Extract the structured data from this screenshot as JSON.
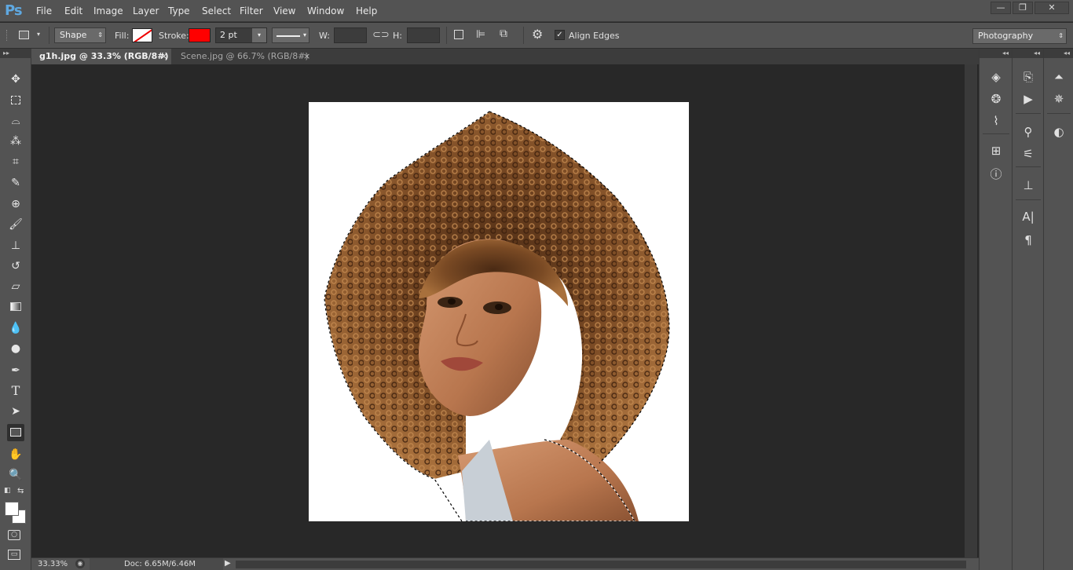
{
  "app": {
    "logo": "Ps"
  },
  "menu": [
    "File",
    "Edit",
    "Image",
    "Layer",
    "Type",
    "Select",
    "Filter",
    "View",
    "Window",
    "Help"
  ],
  "window_controls": {
    "minimize": "—",
    "restore": "❐",
    "close": "✕"
  },
  "options_bar": {
    "mode": "Shape",
    "fill_label": "Fill:",
    "stroke_label": "Stroke:",
    "stroke_color": "#ff0000",
    "stroke_width": "2 pt",
    "w_label": "W:",
    "h_label": "H:",
    "align_edges_label": "Align Edges",
    "align_edges_checked": true,
    "workspace": "Photography"
  },
  "tabs": [
    {
      "title": "g1h.jpg @ 33.3% (RGB/8#) *",
      "active": true,
      "close": "×"
    },
    {
      "title": "Scene.jpg @ 66.7% (RGB/8#)",
      "active": false,
      "close": "×"
    }
  ],
  "status": {
    "zoom": "33.33%",
    "doc": "Doc: 6.65M/6.46M",
    "arrow": "▶"
  },
  "panel_collapse": "◂◂",
  "tools": [
    "move-tool",
    "marquee-tool",
    "lasso-tool",
    "magic-wand-tool",
    "crop-tool",
    "eyedropper-tool",
    "healing-brush-tool",
    "brush-tool",
    "clone-stamp-tool",
    "history-brush-tool",
    "eraser-tool",
    "gradient-tool",
    "blur-tool",
    "dodge-tool",
    "pen-tool",
    "type-tool",
    "path-selection-tool",
    "rectangle-tool",
    "hand-tool",
    "zoom-tool"
  ],
  "colors": {
    "foreground": "#ffffff",
    "background": "#ffffff",
    "accent": "#5fa8e0"
  }
}
